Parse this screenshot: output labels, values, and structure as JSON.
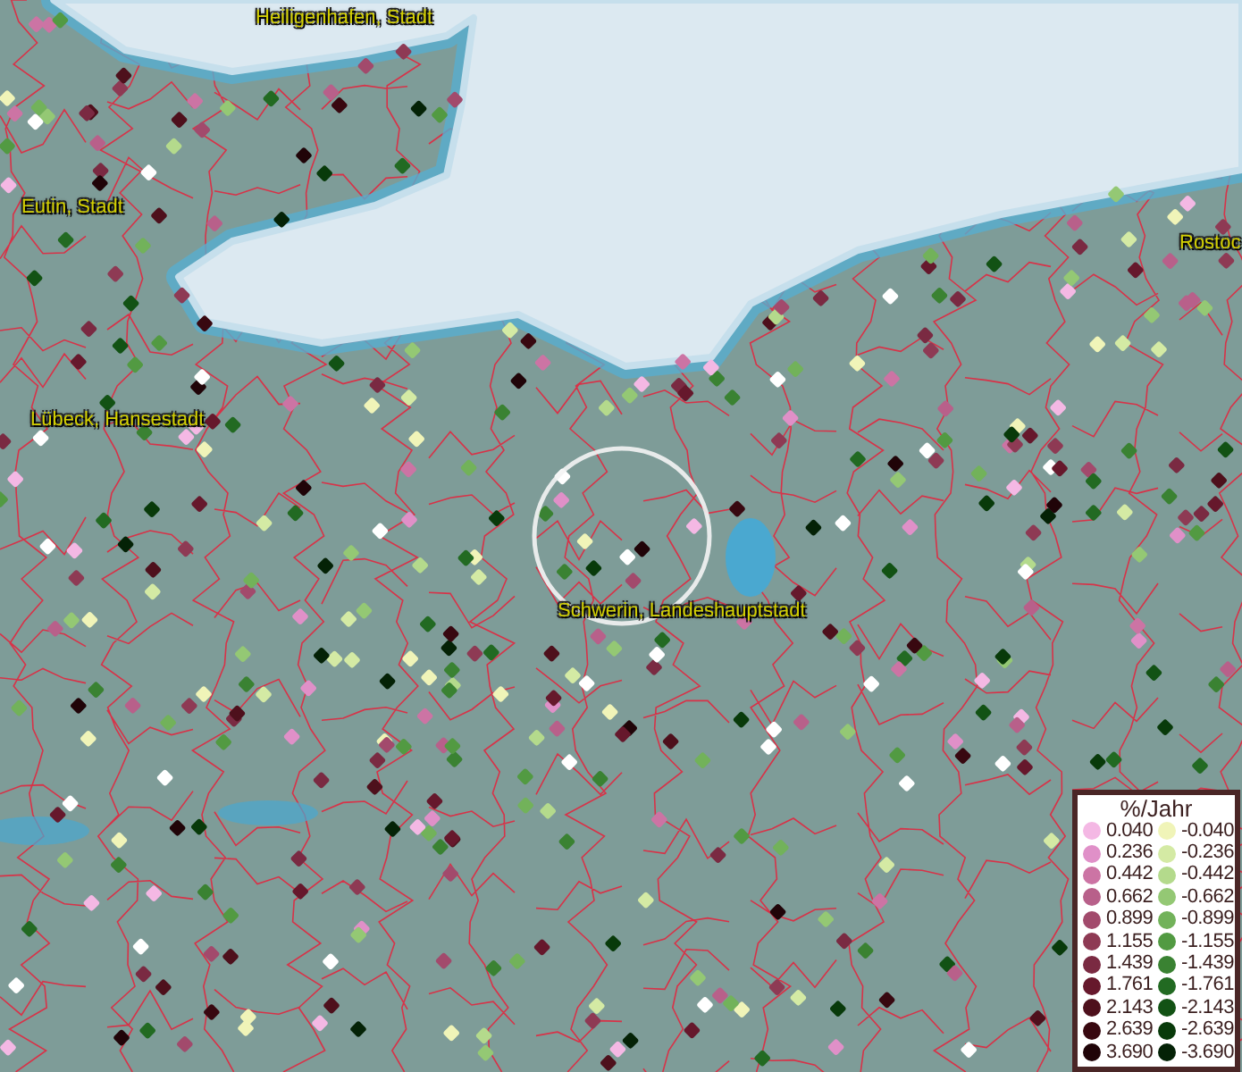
{
  "map": {
    "place_labels": [
      {
        "text": "Heiligenhafen, Stadt"
      },
      {
        "text": "Eutin, Stadt"
      },
      {
        "text": "Lübeck, Hansestadt"
      },
      {
        "text": "Schwerin, Landeshauptstadt"
      },
      {
        "text": "Rostoc"
      }
    ]
  },
  "legend": {
    "title": "%/Jahr",
    "rows": [
      {
        "positive": {
          "label": "0.040",
          "color": "#f4b8e4"
        },
        "negative": {
          "label": "-0.040",
          "color": "#f0f4b8"
        }
      },
      {
        "positive": {
          "label": "0.236",
          "color": "#e090c8"
        },
        "negative": {
          "label": "-0.236",
          "color": "#d4eaa4"
        }
      },
      {
        "positive": {
          "label": "0.442",
          "color": "#cc74a4"
        },
        "negative": {
          "label": "-0.442",
          "color": "#b4da8c"
        }
      },
      {
        "positive": {
          "label": "0.662",
          "color": "#b8608a"
        },
        "negative": {
          "label": "-0.662",
          "color": "#94c874"
        }
      },
      {
        "positive": {
          "label": "0.899",
          "color": "#a24a6c"
        },
        "negative": {
          "label": "-0.899",
          "color": "#72b25a"
        }
      },
      {
        "positive": {
          "label": "1.155",
          "color": "#8e3a54"
        },
        "negative": {
          "label": "-1.155",
          "color": "#529a42"
        }
      },
      {
        "positive": {
          "label": "1.439",
          "color": "#7a2a42"
        },
        "negative": {
          "label": "-1.439",
          "color": "#3a8232"
        }
      },
      {
        "positive": {
          "label": "1.761",
          "color": "#66182c"
        },
        "negative": {
          "label": "-1.761",
          "color": "#226a22"
        }
      },
      {
        "positive": {
          "label": "2.143",
          "color": "#4e101c"
        },
        "negative": {
          "label": "-2.143",
          "color": "#125214"
        }
      },
      {
        "positive": {
          "label": "2.639",
          "color": "#380810"
        },
        "negative": {
          "label": "-2.639",
          "color": "#083a0a"
        }
      },
      {
        "positive": {
          "label": "3.690",
          "color": "#200408"
        },
        "negative": {
          "label": "-3.690",
          "color": "#042206"
        }
      }
    ]
  }
}
